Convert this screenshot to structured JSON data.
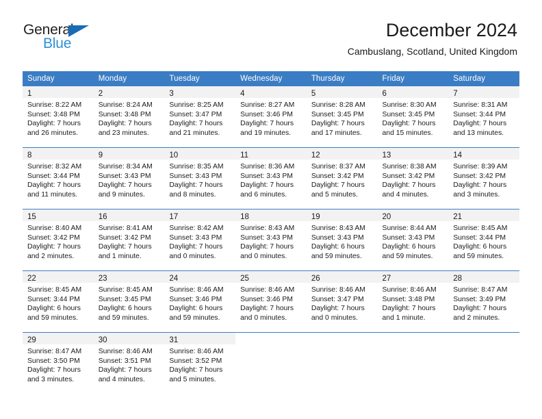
{
  "brand": {
    "name_part1": "General",
    "name_part2": "Blue",
    "triangle_color": "#1a6bb5",
    "blue_text_color": "#2e8fd4"
  },
  "header": {
    "title": "December 2024",
    "subtitle": "Cambuslang, Scotland, United Kingdom",
    "header_bg": "#3b7dc4",
    "daynum_bg": "#f2f2f2"
  },
  "weekday_headers": [
    "Sunday",
    "Monday",
    "Tuesday",
    "Wednesday",
    "Thursday",
    "Friday",
    "Saturday"
  ],
  "weeks": [
    [
      {
        "day": "1",
        "info": "Sunrise: 8:22 AM\nSunset: 3:48 PM\nDaylight: 7 hours\nand 26 minutes."
      },
      {
        "day": "2",
        "info": "Sunrise: 8:24 AM\nSunset: 3:48 PM\nDaylight: 7 hours\nand 23 minutes."
      },
      {
        "day": "3",
        "info": "Sunrise: 8:25 AM\nSunset: 3:47 PM\nDaylight: 7 hours\nand 21 minutes."
      },
      {
        "day": "4",
        "info": "Sunrise: 8:27 AM\nSunset: 3:46 PM\nDaylight: 7 hours\nand 19 minutes."
      },
      {
        "day": "5",
        "info": "Sunrise: 8:28 AM\nSunset: 3:45 PM\nDaylight: 7 hours\nand 17 minutes."
      },
      {
        "day": "6",
        "info": "Sunrise: 8:30 AM\nSunset: 3:45 PM\nDaylight: 7 hours\nand 15 minutes."
      },
      {
        "day": "7",
        "info": "Sunrise: 8:31 AM\nSunset: 3:44 PM\nDaylight: 7 hours\nand 13 minutes."
      }
    ],
    [
      {
        "day": "8",
        "info": "Sunrise: 8:32 AM\nSunset: 3:44 PM\nDaylight: 7 hours\nand 11 minutes."
      },
      {
        "day": "9",
        "info": "Sunrise: 8:34 AM\nSunset: 3:43 PM\nDaylight: 7 hours\nand 9 minutes."
      },
      {
        "day": "10",
        "info": "Sunrise: 8:35 AM\nSunset: 3:43 PM\nDaylight: 7 hours\nand 8 minutes."
      },
      {
        "day": "11",
        "info": "Sunrise: 8:36 AM\nSunset: 3:43 PM\nDaylight: 7 hours\nand 6 minutes."
      },
      {
        "day": "12",
        "info": "Sunrise: 8:37 AM\nSunset: 3:42 PM\nDaylight: 7 hours\nand 5 minutes."
      },
      {
        "day": "13",
        "info": "Sunrise: 8:38 AM\nSunset: 3:42 PM\nDaylight: 7 hours\nand 4 minutes."
      },
      {
        "day": "14",
        "info": "Sunrise: 8:39 AM\nSunset: 3:42 PM\nDaylight: 7 hours\nand 3 minutes."
      }
    ],
    [
      {
        "day": "15",
        "info": "Sunrise: 8:40 AM\nSunset: 3:42 PM\nDaylight: 7 hours\nand 2 minutes."
      },
      {
        "day": "16",
        "info": "Sunrise: 8:41 AM\nSunset: 3:42 PM\nDaylight: 7 hours\nand 1 minute."
      },
      {
        "day": "17",
        "info": "Sunrise: 8:42 AM\nSunset: 3:43 PM\nDaylight: 7 hours\nand 0 minutes."
      },
      {
        "day": "18",
        "info": "Sunrise: 8:43 AM\nSunset: 3:43 PM\nDaylight: 7 hours\nand 0 minutes."
      },
      {
        "day": "19",
        "info": "Sunrise: 8:43 AM\nSunset: 3:43 PM\nDaylight: 6 hours\nand 59 minutes."
      },
      {
        "day": "20",
        "info": "Sunrise: 8:44 AM\nSunset: 3:43 PM\nDaylight: 6 hours\nand 59 minutes."
      },
      {
        "day": "21",
        "info": "Sunrise: 8:45 AM\nSunset: 3:44 PM\nDaylight: 6 hours\nand 59 minutes."
      }
    ],
    [
      {
        "day": "22",
        "info": "Sunrise: 8:45 AM\nSunset: 3:44 PM\nDaylight: 6 hours\nand 59 minutes."
      },
      {
        "day": "23",
        "info": "Sunrise: 8:45 AM\nSunset: 3:45 PM\nDaylight: 6 hours\nand 59 minutes."
      },
      {
        "day": "24",
        "info": "Sunrise: 8:46 AM\nSunset: 3:46 PM\nDaylight: 6 hours\nand 59 minutes."
      },
      {
        "day": "25",
        "info": "Sunrise: 8:46 AM\nSunset: 3:46 PM\nDaylight: 7 hours\nand 0 minutes."
      },
      {
        "day": "26",
        "info": "Sunrise: 8:46 AM\nSunset: 3:47 PM\nDaylight: 7 hours\nand 0 minutes."
      },
      {
        "day": "27",
        "info": "Sunrise: 8:46 AM\nSunset: 3:48 PM\nDaylight: 7 hours\nand 1 minute."
      },
      {
        "day": "28",
        "info": "Sunrise: 8:47 AM\nSunset: 3:49 PM\nDaylight: 7 hours\nand 2 minutes."
      }
    ],
    [
      {
        "day": "29",
        "info": "Sunrise: 8:47 AM\nSunset: 3:50 PM\nDaylight: 7 hours\nand 3 minutes."
      },
      {
        "day": "30",
        "info": "Sunrise: 8:46 AM\nSunset: 3:51 PM\nDaylight: 7 hours\nand 4 minutes."
      },
      {
        "day": "31",
        "info": "Sunrise: 8:46 AM\nSunset: 3:52 PM\nDaylight: 7 hours\nand 5 minutes."
      },
      {
        "day": "",
        "info": ""
      },
      {
        "day": "",
        "info": ""
      },
      {
        "day": "",
        "info": ""
      },
      {
        "day": "",
        "info": ""
      }
    ]
  ]
}
